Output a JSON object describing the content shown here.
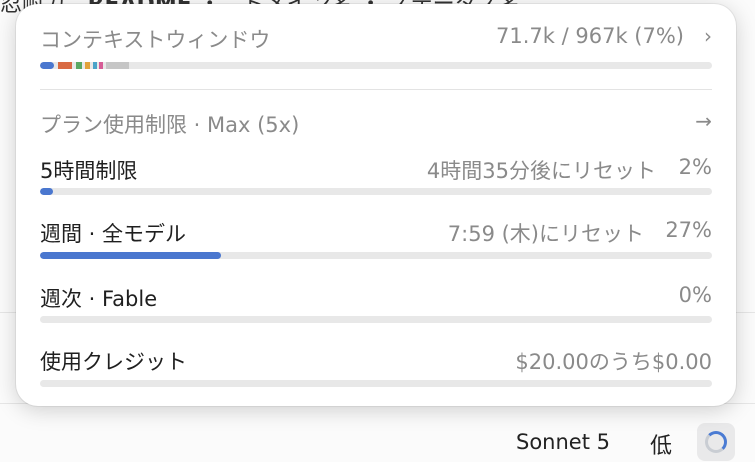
{
  "context": {
    "title": "コンテキストウィンドウ",
    "value": "71.7k / 967k (7%)",
    "chevron": "›"
  },
  "plan": {
    "title": "プラン使用制限 · Max (5x)",
    "arrow": "→"
  },
  "limits": [
    {
      "label": "5時間制限",
      "reset": "4時間35分後にリセット",
      "percent": "2%",
      "fraction": 0.02
    },
    {
      "label": "週間 · 全モデル",
      "reset": "7:59 (木)にリセット",
      "percent": "27%",
      "fraction": 0.27
    },
    {
      "label": "週次 · Fable",
      "reset": "",
      "percent": "0%",
      "fraction": 0.0
    }
  ],
  "credits": {
    "label": "使用クレジット",
    "value": "$20.00のうち$0.00",
    "fraction": 0.0
  },
  "footer": {
    "model": "Sonnet 5",
    "effort": "低"
  },
  "colors": {
    "accent": "#4a77cf",
    "track": "#e8e8e8"
  }
}
